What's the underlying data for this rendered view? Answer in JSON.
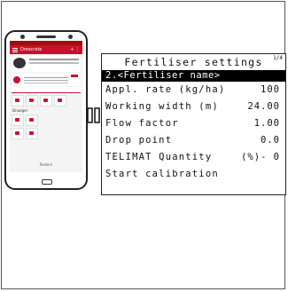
{
  "phone": {
    "app_title": "Drescrate",
    "app_actions": "+  ⋮",
    "section_fertiliser": "Dnuegel",
    "bottom_text": "Ändern"
  },
  "terminal": {
    "title": "Fertiliser settings",
    "page_indicator": "1/4",
    "selected_label": "2.<Fertiliser name>",
    "rows": [
      {
        "label": "Appl. rate (kg/ha)",
        "value": "100"
      },
      {
        "label": "Working width (m)",
        "value": "24.00"
      },
      {
        "label": "Flow factor",
        "value": "1.00"
      },
      {
        "label": "Drop point",
        "value": "0.0"
      },
      {
        "label": "TELIMAT Quantity",
        "value": "(%)- 0"
      },
      {
        "label": "Start calibration",
        "value": ""
      }
    ]
  },
  "colors": {
    "accent": "#c8102e",
    "terminal_border": "#222222"
  },
  "icons": {
    "arrow": "right-arrow-icon",
    "menu": "hamburger-menu-icon"
  }
}
